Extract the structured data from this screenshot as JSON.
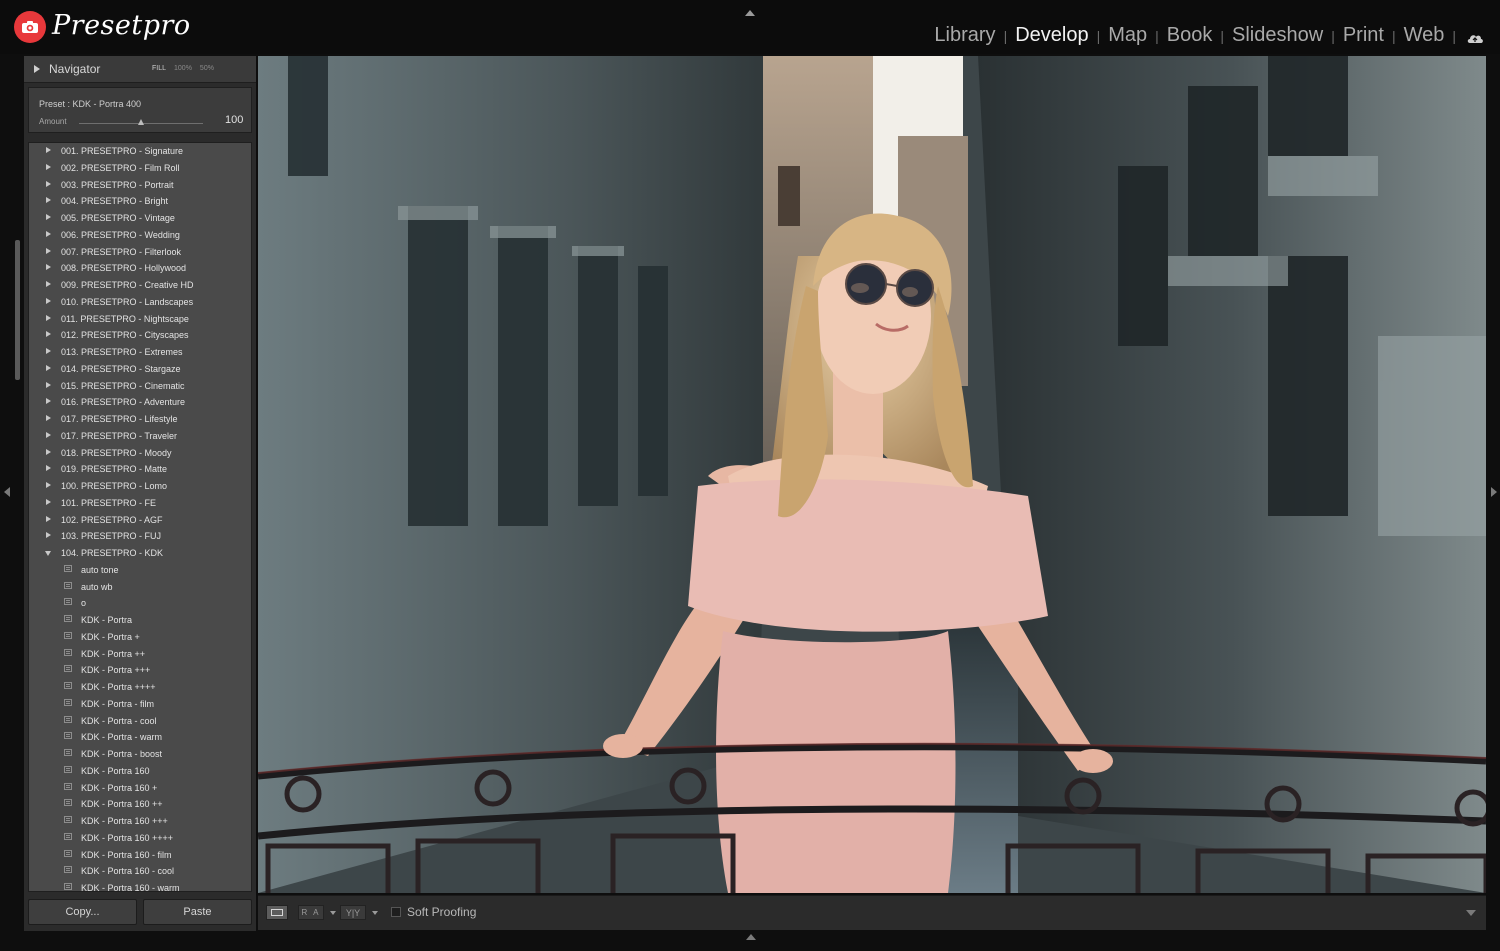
{
  "app": {
    "brand": "Presetpro",
    "accent_color": "#e8383b"
  },
  "modules": [
    {
      "label": "Library",
      "active": false
    },
    {
      "label": "Develop",
      "active": true
    },
    {
      "label": "Map",
      "active": false
    },
    {
      "label": "Book",
      "active": false
    },
    {
      "label": "Slideshow",
      "active": false
    },
    {
      "label": "Print",
      "active": false
    },
    {
      "label": "Web",
      "active": false
    }
  ],
  "module_separator": "|",
  "navigator": {
    "title": "Navigator",
    "fill": "FILL",
    "zoom1": "100%",
    "zoom2": "50%",
    "preset_label": "Preset : KDK - Portra 400",
    "amount_label": "Amount",
    "amount_value": "100",
    "amount_fraction": 0.5
  },
  "preset_folders": [
    "001. PRESETPRO - Signature",
    "002. PRESETPRO - Film Roll",
    "003. PRESETPRO - Portrait",
    "004. PRESETPRO - Bright",
    "005. PRESETPRO - Vintage",
    "006. PRESETPRO - Wedding",
    "007. PRESETPRO - Filterlook",
    "008. PRESETPRO - Hollywood",
    "009. PRESETPRO - Creative HD",
    "010. PRESETPRO - Landscapes",
    "011. PRESETPRO - Nightscape",
    "012. PRESETPRO - Cityscapes",
    "013. PRESETPRO - Extremes",
    "014. PRESETPRO - Stargaze",
    "015. PRESETPRO - Cinematic",
    "016. PRESETPRO - Adventure",
    "017. PRESETPRO - Lifestyle",
    "017. PRESETPRO - Traveler",
    "018. PRESETPRO - Moody",
    "019. PRESETPRO - Matte",
    "100. PRESETPRO - Lomo",
    "101. PRESETPRO - FE",
    "102. PRESETPRO - AGF",
    "103. PRESETPRO - FUJ"
  ],
  "open_folder": "104. PRESETPRO - KDK",
  "open_folder_presets": [
    "auto tone",
    "auto wb",
    "o",
    "KDK - Portra",
    "KDK - Portra +",
    "KDK - Portra ++",
    "KDK - Portra +++",
    "KDK - Portra ++++",
    "KDK - Portra - film",
    "KDK - Portra - cool",
    "KDK - Portra - warm",
    "KDK - Portra - boost",
    "KDK - Portra 160",
    "KDK - Portra 160 +",
    "KDK - Portra 160 ++",
    "KDK - Portra 160 +++",
    "KDK - Portra 160 ++++",
    "KDK - Portra 160 - film",
    "KDK - Portra 160 - cool",
    "KDK - Portra 160 - warm"
  ],
  "buttons": {
    "copy": "Copy...",
    "paste": "Paste"
  },
  "toolbar": {
    "ra_label": "R A",
    "yy_label": "Y|Y",
    "soft_proofing": "Soft Proofing"
  }
}
